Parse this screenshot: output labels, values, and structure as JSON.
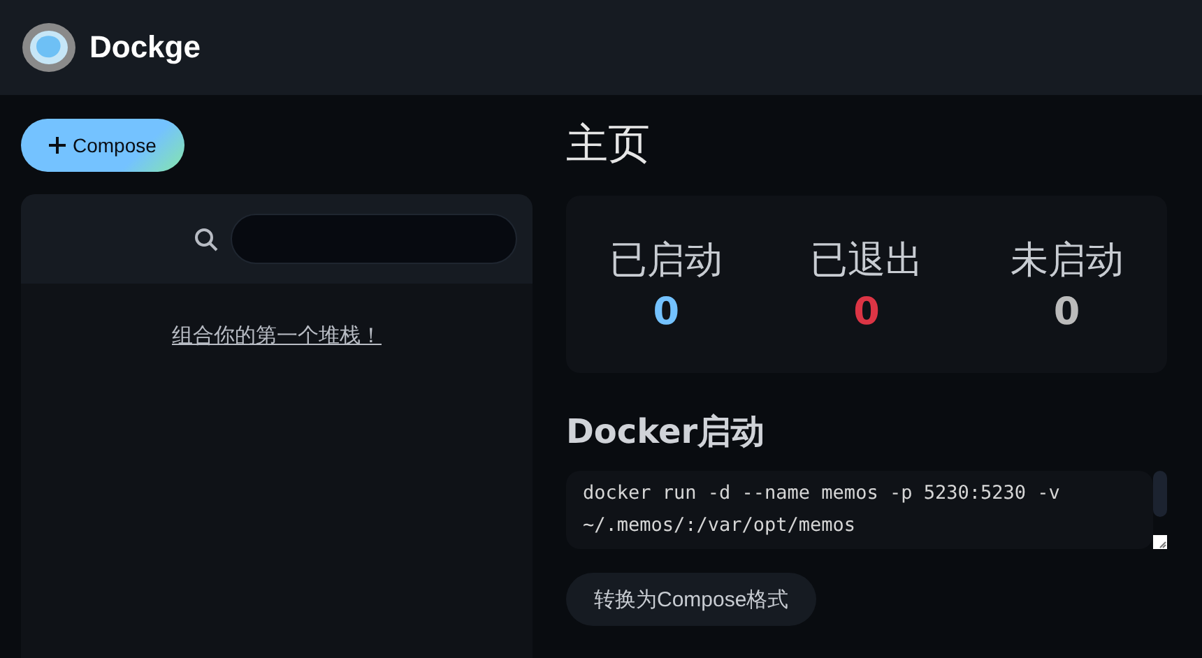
{
  "header": {
    "app_name": "Dockge"
  },
  "sidebar": {
    "compose_button": "Compose",
    "empty_link": "组合你的第一个堆栈！"
  },
  "main": {
    "title": "主页",
    "stats": [
      {
        "label": "已启动",
        "value": "0",
        "color": "#74c2ff"
      },
      {
        "label": "已退出",
        "value": "0",
        "color": "#dc3545"
      },
      {
        "label": "未启动",
        "value": "0",
        "color": "#bbbbbb"
      }
    ],
    "docker_run": {
      "heading": "Docker启动",
      "command": "docker run -d --name memos -p 5230:5230 -v ~/.memos/:/var/opt/memos",
      "convert_button": "转换为Compose格式"
    }
  }
}
